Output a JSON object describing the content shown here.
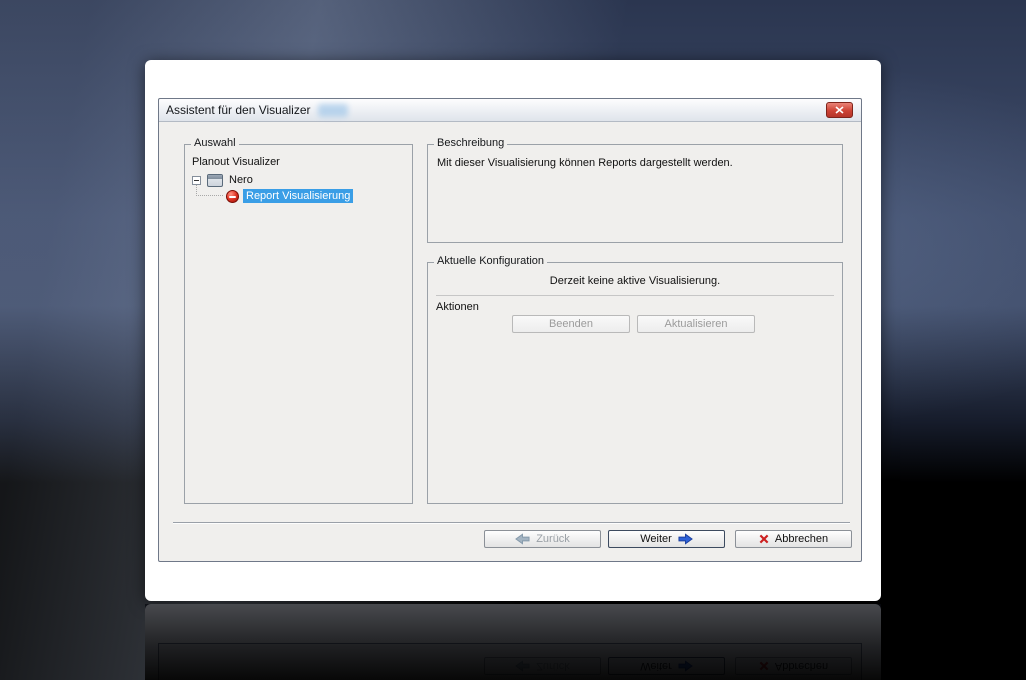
{
  "window": {
    "title": "Assistent für den Visualizer"
  },
  "auswahl": {
    "label": "Auswahl",
    "tree": {
      "root": "Planout Visualizer",
      "parent": "Nero",
      "selected": "Report Visualisierung"
    }
  },
  "beschreibung": {
    "label": "Beschreibung",
    "text": "Mit dieser Visualisierung können Reports dargestellt werden."
  },
  "konfiguration": {
    "label": "Aktuelle Konfiguration",
    "status": "Derzeit keine aktive Visualisierung.",
    "aktionen_label": "Aktionen",
    "beenden_label": "Beenden",
    "aktualisieren_label": "Aktualisieren"
  },
  "footer": {
    "zurueck_label": "Zurück",
    "weiter_label": "Weiter",
    "abbrechen_label": "Abbrechen"
  },
  "icons": {
    "close": "close-x-icon",
    "back": "left-arrow-icon",
    "next": "right-arrow-icon",
    "cancel": "red-x-icon",
    "tree_expand": "minus-box-icon",
    "nero": "window-icon",
    "report": "red-sphere-icon"
  },
  "colors": {
    "selection_blue": "#3a9ee6",
    "close_red": "#cd4335",
    "next_arrow_blue": "#2e62d9",
    "cancel_red": "#cc2020"
  }
}
